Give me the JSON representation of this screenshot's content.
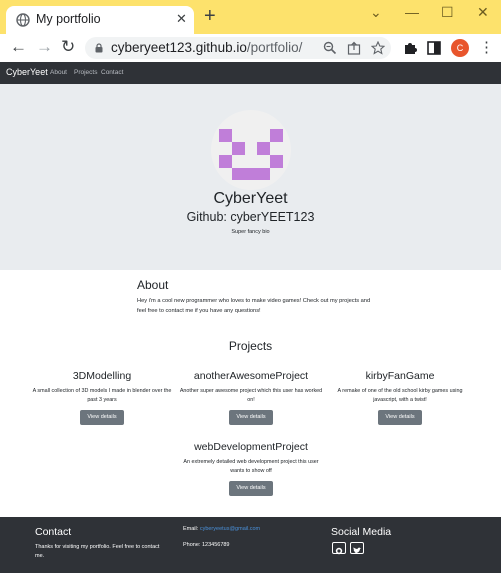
{
  "browser": {
    "tab_title": "My portfolio",
    "url_host": "cyberyeet123.github.io",
    "url_path": "/portfolio/",
    "profile_initial": "C",
    "accent_color": "#fde26c"
  },
  "navbar": {
    "brand": "CyberYeet",
    "links": [
      "About",
      "Projects",
      "Contact"
    ]
  },
  "hero": {
    "name": "CyberYeet",
    "github": "Github: cyberYEET123",
    "bio": "Super fancy bio"
  },
  "about": {
    "title": "About",
    "text": "Hey i'm a cool new programmer who loves to make video games! Check out my projects and feel free to contact me if you have any questions!"
  },
  "projects": {
    "title": "Projects",
    "button_label": "View details",
    "items": [
      {
        "name": "3DModelling",
        "desc": "A small collection of 3D models I made in blender over the past 3 years"
      },
      {
        "name": "anotherAwesomeProject",
        "desc": "Another super awesome project which this user has worked on!"
      },
      {
        "name": "kirbyFanGame",
        "desc": "A remake of one of the old school kirby games using javascript, with a twist!"
      },
      {
        "name": "webDevelopmentProject",
        "desc": "An extremely detailed web development project this user wants to show off"
      }
    ]
  },
  "footer": {
    "contact_title": "Contact",
    "contact_text": "Thanks for visiting my portfolio. Feel free to contact me.",
    "email_label": "Email:",
    "email_value": "cyberyeetus@gmail.com",
    "phone": "Phone: 123456789",
    "social_title": "Social Media",
    "social_icons": [
      "github-icon",
      "twitter-icon"
    ]
  }
}
